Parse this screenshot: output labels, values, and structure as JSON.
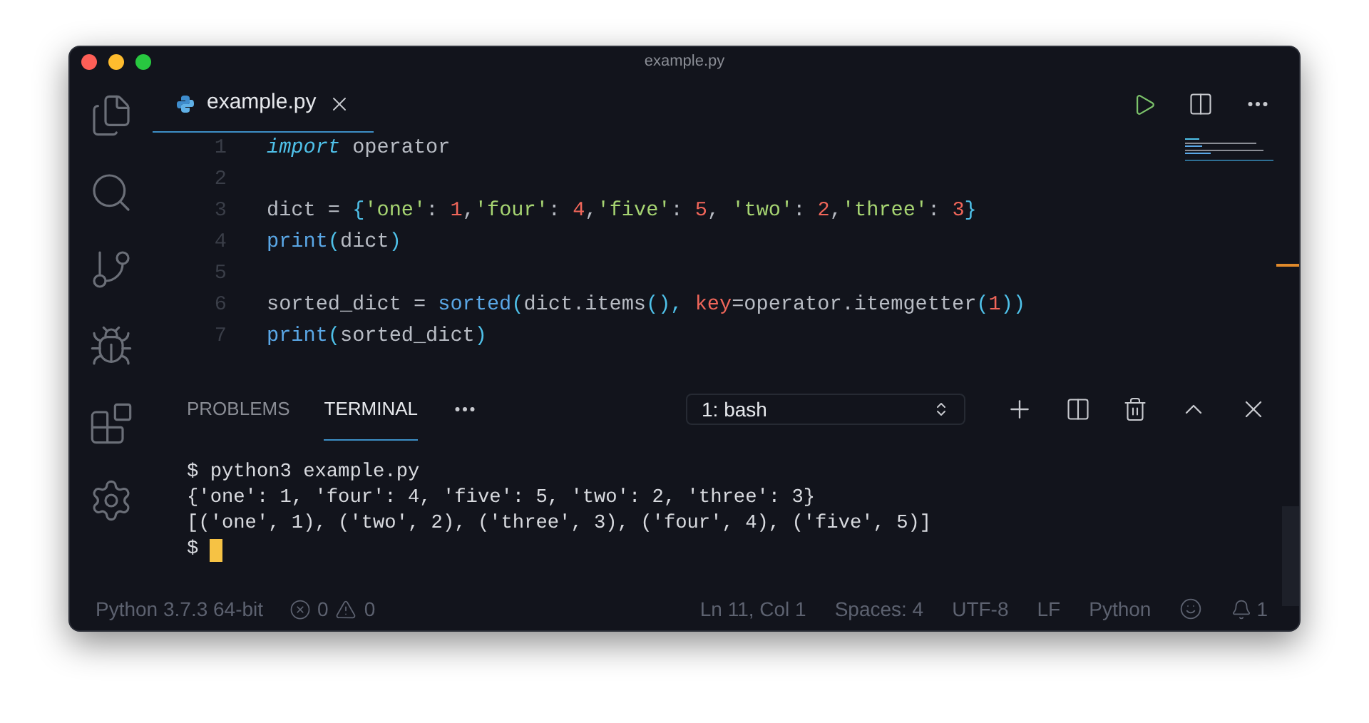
{
  "window": {
    "title": "example.py"
  },
  "activity_bar": [
    {
      "kind": "files",
      "selected": false
    },
    {
      "kind": "search",
      "selected": false
    },
    {
      "kind": "git",
      "selected": false
    },
    {
      "kind": "debug",
      "selected": false
    },
    {
      "kind": "extensions",
      "selected": false
    },
    {
      "kind": "settings",
      "selected": false
    }
  ],
  "tabs": [
    {
      "label": "example.py",
      "selected": true
    }
  ],
  "editor": {
    "lines": [
      {
        "number": "1",
        "tokens": [
          {
            "text": "import",
            "kind": "keyword"
          },
          {
            "text": " operator",
            "kind": "plain"
          }
        ]
      },
      {
        "number": "2"
      },
      {
        "number": "3",
        "tokens": [
          {
            "text": "dict = ",
            "kind": "plain"
          },
          {
            "text": "{",
            "kind": "punct"
          },
          {
            "text": "'one'",
            "kind": "string"
          },
          {
            "text": ": ",
            "kind": "plain"
          },
          {
            "text": "1",
            "kind": "number"
          },
          {
            "text": ",",
            "kind": "plain"
          },
          {
            "text": "'four'",
            "kind": "string"
          },
          {
            "text": ": ",
            "kind": "plain"
          },
          {
            "text": "4",
            "kind": "number"
          },
          {
            "text": ",",
            "kind": "plain"
          },
          {
            "text": "'five'",
            "kind": "string"
          },
          {
            "text": ": ",
            "kind": "plain"
          },
          {
            "text": "5",
            "kind": "number"
          },
          {
            "text": ", ",
            "kind": "plain"
          },
          {
            "text": "'two'",
            "kind": "string"
          },
          {
            "text": ": ",
            "kind": "plain"
          },
          {
            "text": "2",
            "kind": "number"
          },
          {
            "text": ",",
            "kind": "plain"
          },
          {
            "text": "'three'",
            "kind": "string"
          },
          {
            "text": ": ",
            "kind": "plain"
          },
          {
            "text": "3",
            "kind": "number"
          },
          {
            "text": "}",
            "kind": "punct"
          }
        ]
      },
      {
        "number": "4",
        "tokens": [
          {
            "text": "print",
            "kind": "function"
          },
          {
            "text": "(",
            "kind": "punct"
          },
          {
            "text": "dict",
            "kind": "plain"
          },
          {
            "text": ")",
            "kind": "punct"
          }
        ]
      },
      {
        "number": "5"
      },
      {
        "number": "6",
        "tokens": [
          {
            "text": "sorted_dict = ",
            "kind": "plain"
          },
          {
            "text": "sorted",
            "kind": "function"
          },
          {
            "text": "(",
            "kind": "punct"
          },
          {
            "text": "dict.items",
            "kind": "plain"
          },
          {
            "text": "(), ",
            "kind": "punct"
          },
          {
            "text": "key",
            "kind": "parameter"
          },
          {
            "text": "=operator.itemgetter",
            "kind": "plain"
          },
          {
            "text": "(",
            "kind": "punct"
          },
          {
            "text": "1",
            "kind": "number"
          },
          {
            "text": "))",
            "kind": "punct"
          }
        ]
      },
      {
        "number": "7",
        "tokens": [
          {
            "text": "print",
            "kind": "function"
          },
          {
            "text": "(",
            "kind": "punct"
          },
          {
            "text": "sorted_dict",
            "kind": "plain"
          },
          {
            "text": ")",
            "kind": "punct"
          }
        ]
      }
    ]
  },
  "panel": {
    "tabs": [
      {
        "label": "PROBLEMS",
        "selected": false
      },
      {
        "label": "TERMINAL",
        "selected": true
      }
    ],
    "terminal_select": "1: bash",
    "terminal_lines": [
      "$ python3 example.py",
      "{'one': 1, 'four': 4, 'five': 5, 'two': 2, 'three': 3}",
      "[('one', 1), ('two', 2), ('three', 3), ('four', 4), ('five', 5)]",
      "$ "
    ]
  },
  "status_bar": {
    "interpreter": "Python 3.7.3 64-bit",
    "errors": "0",
    "warnings": "0",
    "position": "Ln 11, Col 1",
    "indent": "Spaces: 4",
    "encoding": "UTF-8",
    "eol": "LF",
    "language": "Python",
    "notifications": "1"
  }
}
